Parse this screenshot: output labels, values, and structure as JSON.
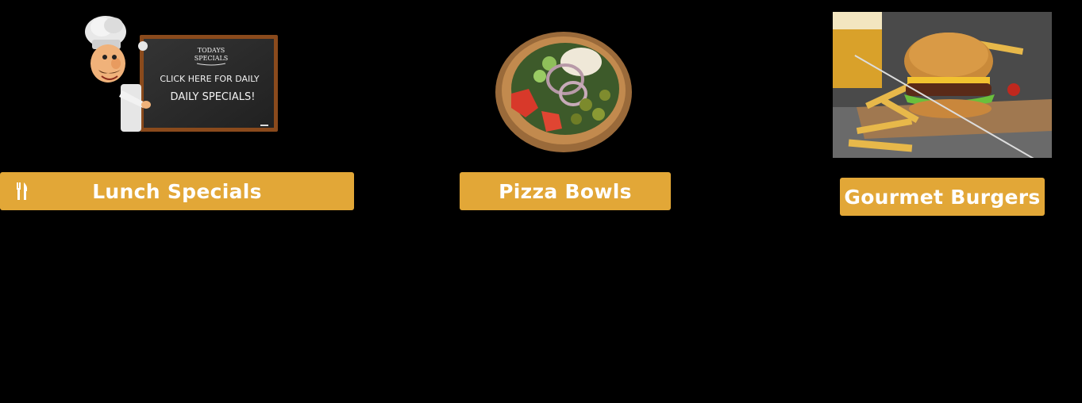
{
  "colors": {
    "background": "#000000",
    "button": "#e2a737",
    "button_text": "#ffffff"
  },
  "tiles": [
    {
      "image": {
        "board_line1": "TODAYS",
        "board_line2": "SPECIALS",
        "board_line3": "CLICK HERE FOR DAILY",
        "board_line4": "DAILY SPECIALS!"
      },
      "button_label": "Lunch Specials",
      "button_icon": "fork-knife-icon"
    },
    {
      "button_label": "Pizza Bowls"
    },
    {
      "button_label": "Gourmet Burgers"
    }
  ]
}
